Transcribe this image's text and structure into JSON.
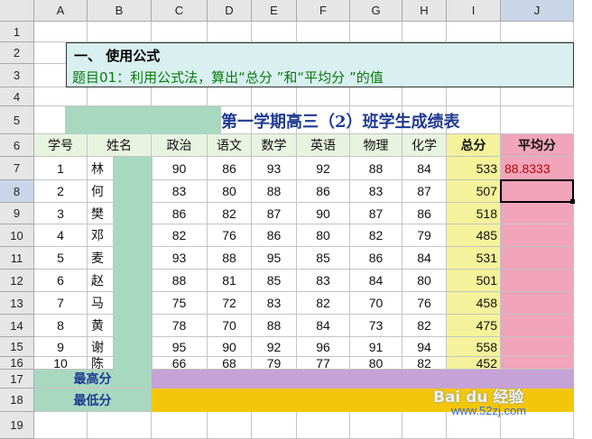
{
  "columns": [
    "A",
    "B",
    "C",
    "D",
    "E",
    "F",
    "G",
    "H",
    "I",
    "J"
  ],
  "rows": [
    "1",
    "2",
    "3",
    "4",
    "5",
    "6",
    "7",
    "8",
    "9",
    "10",
    "11",
    "12",
    "13",
    "14",
    "15",
    "16",
    "17",
    "18",
    "19"
  ],
  "selected_cell": {
    "column": "J",
    "row": "8"
  },
  "info_box": {
    "heading": "一、  使用公式",
    "task": "题目01：利用公式法，算出“总分 ”和“平均分 ”的值"
  },
  "table_title": "第一学期高三（2）班学生成绩表",
  "table_headers": [
    "学号",
    "姓名",
    "政治",
    "语文",
    "数学",
    "英语",
    "物理",
    "化学",
    "总分",
    "平均分"
  ],
  "students": [
    {
      "id": "1",
      "name": "林",
      "scores": [
        "90",
        "86",
        "93",
        "92",
        "88",
        "84"
      ],
      "total": "533",
      "avg": "88.8333"
    },
    {
      "id": "2",
      "name": "何",
      "scores": [
        "83",
        "80",
        "88",
        "86",
        "83",
        "87"
      ],
      "total": "507",
      "avg": ""
    },
    {
      "id": "3",
      "name": "樊",
      "scores": [
        "86",
        "82",
        "87",
        "90",
        "87",
        "86"
      ],
      "total": "518",
      "avg": ""
    },
    {
      "id": "4",
      "name": "邓",
      "scores": [
        "82",
        "76",
        "86",
        "80",
        "82",
        "79"
      ],
      "total": "485",
      "avg": ""
    },
    {
      "id": "5",
      "name": "麦",
      "scores": [
        "93",
        "88",
        "95",
        "85",
        "86",
        "84"
      ],
      "total": "531",
      "avg": ""
    },
    {
      "id": "6",
      "name": "赵",
      "scores": [
        "88",
        "81",
        "85",
        "83",
        "84",
        "80"
      ],
      "total": "501",
      "avg": ""
    },
    {
      "id": "7",
      "name": "马",
      "scores": [
        "75",
        "72",
        "83",
        "82",
        "70",
        "76"
      ],
      "total": "458",
      "avg": ""
    },
    {
      "id": "8",
      "name": "黄",
      "scores": [
        "78",
        "70",
        "88",
        "84",
        "73",
        "82"
      ],
      "total": "475",
      "avg": ""
    },
    {
      "id": "9",
      "name": "谢",
      "scores": [
        "95",
        "90",
        "92",
        "96",
        "91",
        "94"
      ],
      "total": "558",
      "avg": ""
    },
    {
      "id": "10",
      "name": "陈",
      "scores": [
        "66",
        "68",
        "79",
        "77",
        "80",
        "82"
      ],
      "total": "452",
      "avg": ""
    }
  ],
  "summary_labels": {
    "max": "最高分",
    "min": "最低分"
  },
  "watermark": {
    "brand": "Bai du 经验",
    "site": "www.52zj.com"
  },
  "colors": {
    "info_bg": "#d8f0ef",
    "name_green": "#a8d8c0",
    "total_yellow": "#f4f29a",
    "avg_pink": "#f1a4ba",
    "max_purple": "#c6a2d6",
    "min_orange": "#f4c60a",
    "title_blue": "#1f3a93",
    "header_bg": "#e6e6e6",
    "grid": "#c4c4c4"
  }
}
